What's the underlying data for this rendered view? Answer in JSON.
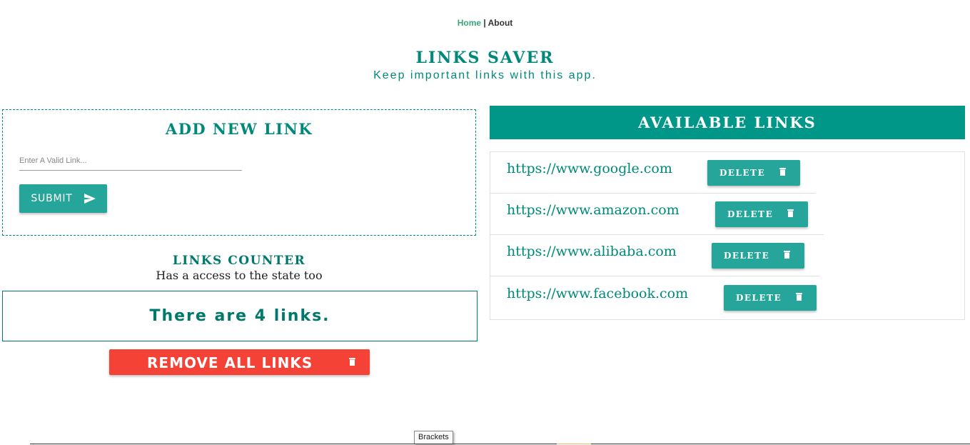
{
  "nav": {
    "home": "Home",
    "separator": "|",
    "about": "About"
  },
  "header": {
    "title": "LINKS SAVER",
    "subtitle": "Keep important links with this app."
  },
  "add_form": {
    "title": "ADD NEW LINK",
    "input_placeholder": "Enter A Valid Link...",
    "input_value": "",
    "submit_label": "SUBMIT",
    "submit_icon": "send-icon"
  },
  "counter": {
    "title": "LINKS COUNTER",
    "subtitle": "Has a access to the state too",
    "text": "There are 4 links."
  },
  "remove_all": {
    "label": "REMOVE ALL LINKS",
    "icon": "trash-icon"
  },
  "available": {
    "title": "AVAILABLE LINKS",
    "links": [
      {
        "url": "https://www.google.com",
        "delete_label": "DELETE"
      },
      {
        "url": "https://www.amazon.com",
        "delete_label": "DELETE"
      },
      {
        "url": "https://www.alibaba.com",
        "delete_label": "DELETE"
      },
      {
        "url": "https://www.facebook.com",
        "delete_label": "DELETE"
      }
    ]
  },
  "taskbar": {
    "tooltip": "Brackets"
  },
  "colors": {
    "teal": "#009688",
    "teal_button": "#26a69a",
    "teal_text": "#00897b",
    "red": "#f44336",
    "nav_home": "#3aa87a"
  }
}
